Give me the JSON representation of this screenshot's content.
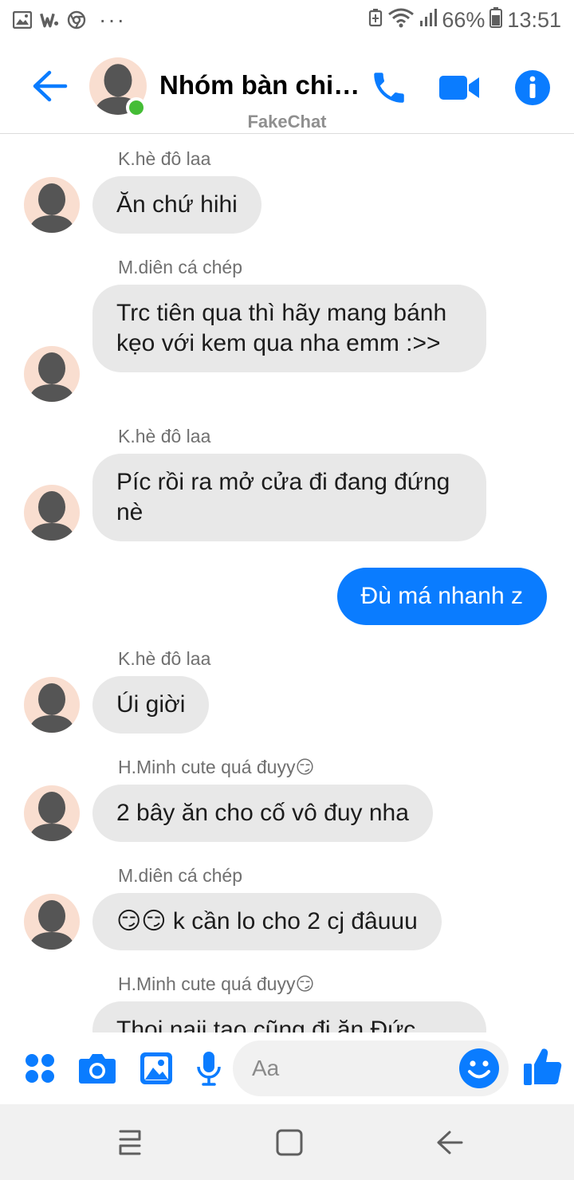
{
  "status_bar": {
    "battery": "66%",
    "time": "13:51",
    "more": "···",
    "icons": [
      "image-notification-icon",
      "w-app-icon",
      "chrome-icon",
      "battery-saver-icon",
      "wifi-icon",
      "signal-icon",
      "battery-icon"
    ]
  },
  "header": {
    "title": "Nhóm bàn chiệ…",
    "watermark": "FakeChat",
    "online": true,
    "icons": [
      "back-arrow-icon",
      "phone-icon",
      "video-camera-icon",
      "info-icon"
    ]
  },
  "messages": [
    {
      "sender": "K.hè đô laa",
      "text": "Ăn chứ hihi",
      "outgoing": false
    },
    {
      "sender": "M.diên cá chép",
      "text": "Trc tiên qua thì hãy mang bánh kẹo với kem qua nha emm :>>",
      "outgoing": false
    },
    {
      "sender": "K.hè đô laa",
      "text": "Píc rồi ra mở cửa đi đang đứng nè",
      "outgoing": false
    },
    {
      "sender": "",
      "text": "Đù má nhanh z",
      "outgoing": true
    },
    {
      "sender": "K.hè đô laa",
      "text": "Úi giời",
      "outgoing": false
    },
    {
      "sender": "H.Minh cute quá đuyy😏",
      "text": "2 bây ăn cho cố vô đuy nha",
      "outgoing": false
    },
    {
      "sender": "M.diên cá chép",
      "text": "😏😏 k cần lo cho 2 cj đâuuu",
      "outgoing": false
    },
    {
      "sender": "H.Minh cute quá đuyy😏",
      "text": "Thoi naii tao cũng đi ăn Đức",
      "outgoing": false
    }
  ],
  "composer": {
    "placeholder": "Aa",
    "icons": [
      "apps-grid-icon",
      "camera-icon",
      "gallery-icon",
      "microphone-icon",
      "emoji-icon",
      "thumbs-up-icon"
    ]
  },
  "nav_bar": {
    "icons": [
      "recent-apps-icon",
      "home-icon",
      "back-icon"
    ]
  },
  "colors": {
    "accent": "#0A7CFF",
    "incoming_bubble": "#E8E8E8",
    "online": "#45BD36",
    "avatar_bg": "#F9DED0",
    "avatar_silhouette": "#555555"
  }
}
